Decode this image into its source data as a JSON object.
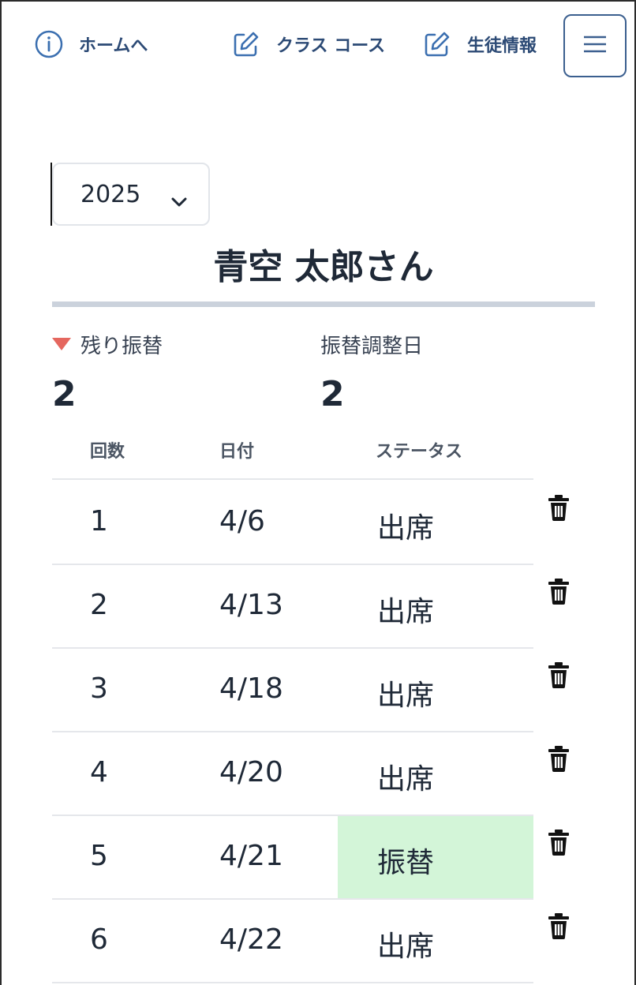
{
  "nav": {
    "home_label": "ホームへ",
    "class_course_label": "クラス コース",
    "student_info_label": "生徒情報",
    "home_icon": "info-icon",
    "edit_icon": "edit-icon",
    "menu_icon": "hamburger-icon"
  },
  "year_select": {
    "value": "2025"
  },
  "student": {
    "name": "青空 太郎さん"
  },
  "stats": {
    "remaining_label": "残り振替",
    "remaining_value": "2",
    "adjust_label": "振替調整日",
    "adjust_value": "2"
  },
  "table": {
    "headers": {
      "count": "回数",
      "date": "日付",
      "status": "ステータス"
    },
    "rows": [
      {
        "count": "1",
        "date": "4/6",
        "status": "出席",
        "highlight": false
      },
      {
        "count": "2",
        "date": "4/13",
        "status": "出席",
        "highlight": false
      },
      {
        "count": "3",
        "date": "4/18",
        "status": "出席",
        "highlight": false
      },
      {
        "count": "4",
        "date": "4/20",
        "status": "出席",
        "highlight": false
      },
      {
        "count": "5",
        "date": "4/21",
        "status": "振替",
        "highlight": true
      },
      {
        "count": "6",
        "date": "4/22",
        "status": "出席",
        "highlight": false
      }
    ]
  },
  "colors": {
    "nav_text": "#2c4a75",
    "highlight_bg": "#d3f5d8",
    "remaining_indicator": "#e5675f"
  }
}
